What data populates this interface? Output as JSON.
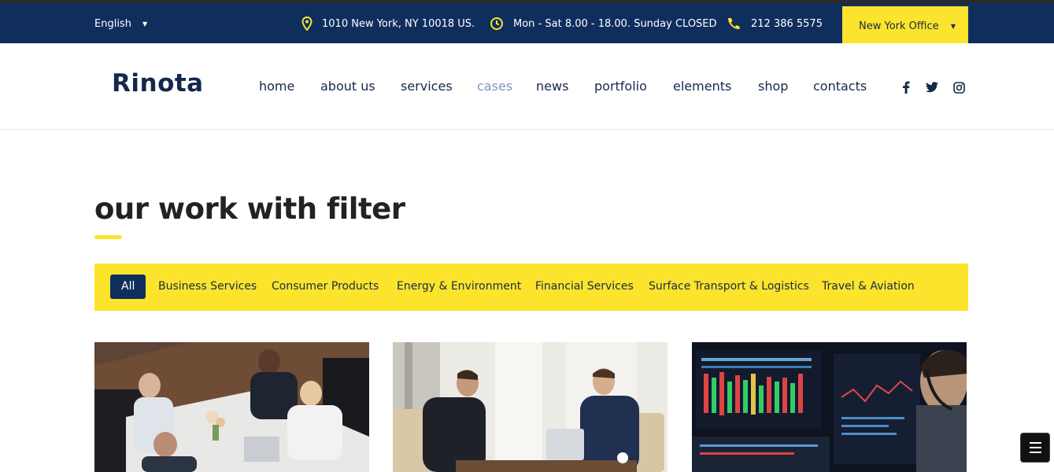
{
  "topbar": {
    "language": "English",
    "address": "1010 New York, NY 10018 US.",
    "hours": "Mon - Sat 8.00 - 18.00. Sunday CLOSED",
    "phone": "212 386 5575",
    "office_select": "New York Office",
    "icons": [
      "map-pin-icon",
      "clock-icon",
      "phone-icon"
    ]
  },
  "header": {
    "logo": "Rinota",
    "nav": [
      "home",
      "about us",
      "services",
      "cases",
      "news",
      "portfolio",
      "elements",
      "shop",
      "contacts"
    ],
    "active_nav": "cases",
    "social": [
      "facebook-icon",
      "twitter-icon",
      "instagram-icon"
    ]
  },
  "section": {
    "title": "our work with filter",
    "filters": [
      "All",
      "Business Services",
      "Consumer Products",
      "Energy & Environment",
      "Financial Services",
      "Surface Transport & Logistics",
      "Travel & Aviation"
    ],
    "active_filter": "All"
  },
  "colors": {
    "navy": "#0f2e5e",
    "accent_yellow": "#fbe42b",
    "active_nav": "#7d93c3"
  }
}
